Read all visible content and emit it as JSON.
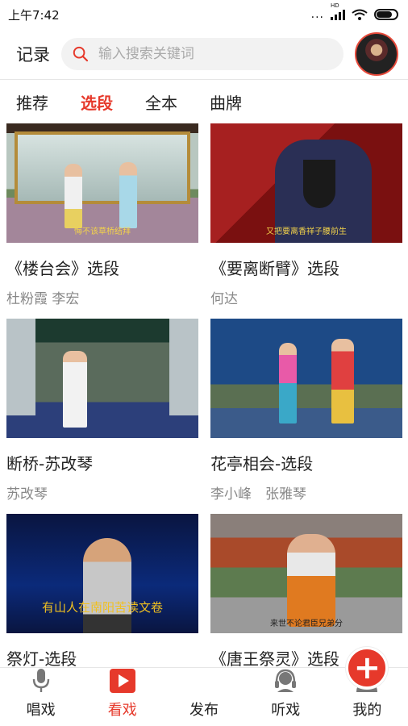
{
  "status_bar": {
    "time": "上午7:42",
    "dots": "...",
    "network": "HD"
  },
  "header": {
    "record_label": "记录",
    "search_placeholder": "输入搜索关键词"
  },
  "tabs": [
    {
      "label": "推荐",
      "active": false
    },
    {
      "label": "选段",
      "active": true
    },
    {
      "label": "全本",
      "active": false
    },
    {
      "label": "曲牌",
      "active": false
    }
  ],
  "cards": [
    {
      "title": "《楼台会》选段",
      "performers": "杜粉霞 李宏",
      "thumb_caption": "悔不该草桥结拜"
    },
    {
      "title": "《要离断臂》选段",
      "performers": "何达",
      "thumb_caption": "又把要离香祥子腰前生"
    },
    {
      "title": "断桥-苏改琴",
      "performers": "苏改琴",
      "thumb_caption": ""
    },
    {
      "title": "花亭相会-选段",
      "performers": "李小峰　张雅琴",
      "thumb_caption": ""
    },
    {
      "title": "祭灯-选段",
      "performers": "",
      "thumb_caption": "有山人在南阳苦读文卷"
    },
    {
      "title": "《唐王祭灵》选段",
      "performers": "",
      "thumb_caption": "来世不论君臣兄弟分"
    }
  ],
  "bottom_nav": [
    {
      "label": "唱戏",
      "icon": "microphone-icon",
      "active": false
    },
    {
      "label": "看戏",
      "icon": "play-icon",
      "active": true
    },
    {
      "label": "发布",
      "icon": "plus-icon",
      "active": false
    },
    {
      "label": "听戏",
      "icon": "headphones-icon",
      "active": false
    },
    {
      "label": "我的",
      "icon": "user-icon",
      "active": false
    }
  ],
  "colors": {
    "accent": "#e6392b",
    "muted_text": "#888888",
    "search_bg": "#f2f2f2"
  }
}
